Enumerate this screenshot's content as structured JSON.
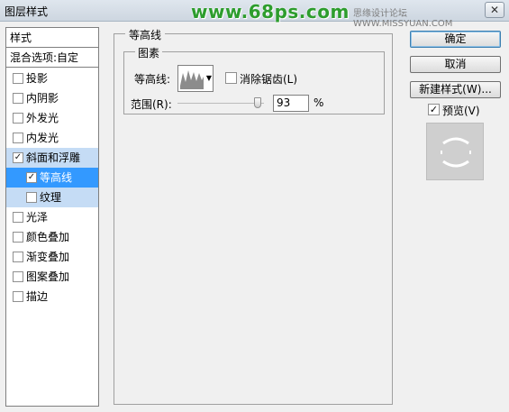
{
  "window": {
    "title": "图层样式",
    "watermark": "www.68ps.com",
    "site_text": "思缘设计论坛 WWW.MISSYUAN.COM",
    "close_glyph": "✕"
  },
  "styles_panel": {
    "header": "样式",
    "blend_options": "混合选项:自定",
    "items": [
      {
        "label": "投影",
        "checked": false
      },
      {
        "label": "内阴影",
        "checked": false
      },
      {
        "label": "外发光",
        "checked": false
      },
      {
        "label": "内发光",
        "checked": false
      },
      {
        "label": "斜面和浮雕",
        "checked": true
      },
      {
        "label": "等高线",
        "checked": true
      },
      {
        "label": "纹理",
        "checked": false
      },
      {
        "label": "光泽",
        "checked": false
      },
      {
        "label": "颜色叠加",
        "checked": false
      },
      {
        "label": "渐变叠加",
        "checked": false
      },
      {
        "label": "图案叠加",
        "checked": false
      },
      {
        "label": "描边",
        "checked": false
      }
    ]
  },
  "contour_group": {
    "legend": "等高线",
    "elements_legend": "图素",
    "contour_label": "等高线:",
    "antialias_label": "消除锯齿(L)",
    "antialias_checked": false,
    "range_label": "范围(R):",
    "range_value": "93",
    "range_unit": "%",
    "range_fraction": 0.93
  },
  "buttons": {
    "ok": "确定",
    "cancel": "取消",
    "new_style": "新建样式(W)...",
    "preview_label": "预览(V)",
    "preview_checked": true
  },
  "check_glyph": "✓",
  "colors": {
    "selected": "#3399ff",
    "selected_parent": "#c5dcf5",
    "watermark": "#2d9d2d"
  }
}
